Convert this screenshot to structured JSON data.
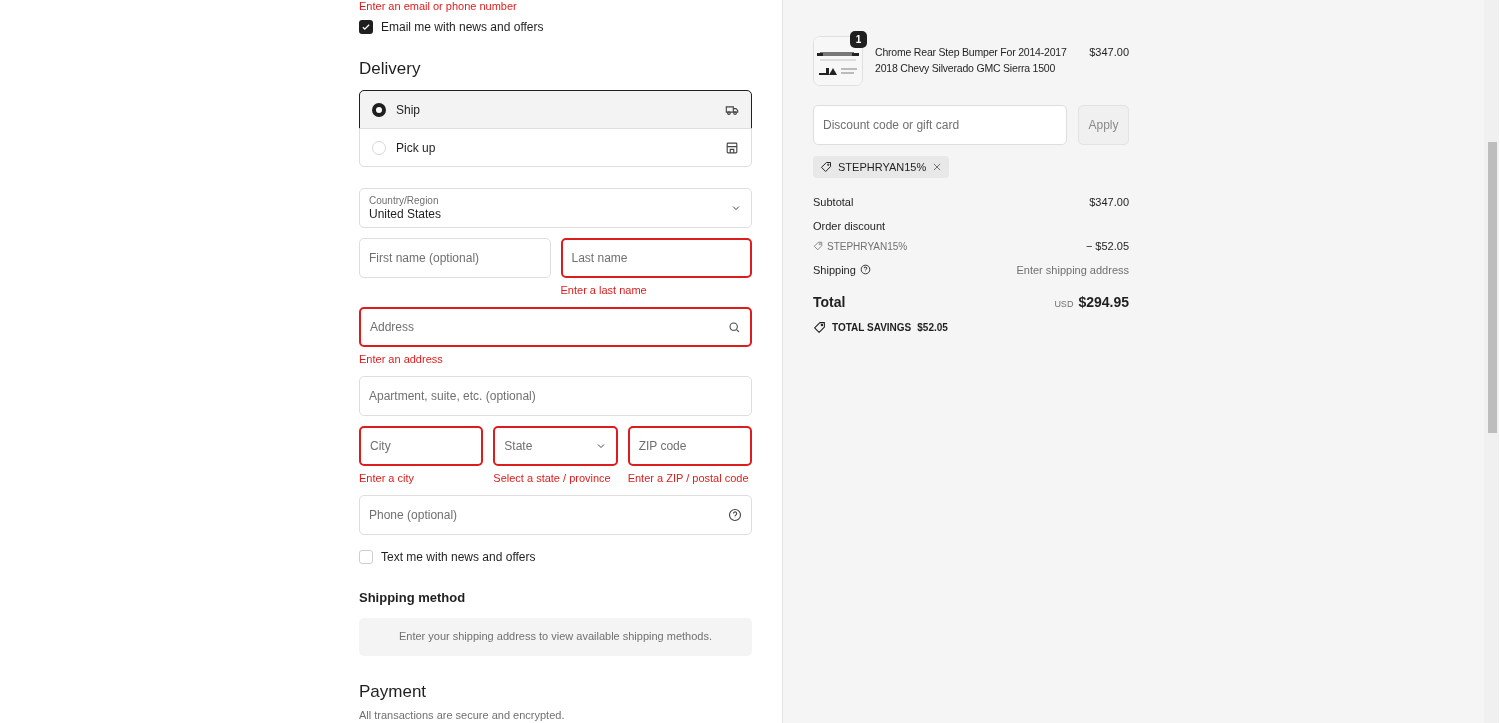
{
  "contact_error": "Enter an email or phone number",
  "email_optin": {
    "label": "Email me with news and offers",
    "checked": true
  },
  "delivery": {
    "title": "Delivery",
    "options": [
      {
        "label": "Ship",
        "selected": true
      },
      {
        "label": "Pick up",
        "selected": false
      }
    ]
  },
  "address_rows": [
    [
      {
        "kind": "select",
        "label": "Country/Region",
        "value": "United States",
        "invalid": false
      }
    ],
    [
      {
        "kind": "text",
        "placeholder": "First name (optional)",
        "invalid": false
      },
      {
        "kind": "text",
        "placeholder": "Last name",
        "invalid": true,
        "error": "Enter a last name"
      }
    ],
    [
      {
        "kind": "search",
        "placeholder": "Address",
        "invalid": true,
        "error": "Enter an address"
      }
    ],
    [
      {
        "kind": "text",
        "placeholder": "Apartment, suite, etc. (optional)",
        "invalid": false
      }
    ],
    [
      {
        "kind": "text",
        "placeholder": "City",
        "invalid": true,
        "error": "Enter a city"
      },
      {
        "kind": "dropdown",
        "placeholder": "State",
        "invalid": true,
        "error": "Select a state / province"
      },
      {
        "kind": "text",
        "placeholder": "ZIP code",
        "invalid": true,
        "error": "Enter a ZIP / postal code"
      }
    ],
    [
      {
        "kind": "help",
        "placeholder": "Phone (optional)",
        "invalid": false
      }
    ]
  ],
  "sms_optin": {
    "label": "Text me with news and offers",
    "checked": false
  },
  "shipping_method": {
    "title": "Shipping method",
    "message": "Enter your shipping address to view available shipping methods."
  },
  "payment": {
    "title": "Payment",
    "subtitle": "All transactions are secure and encrypted."
  },
  "summary": {
    "item": {
      "quantity": "1",
      "name": "Chrome Rear Step Bumper For 2014-2017 2018 Chevy Silverado GMC Sierra 1500",
      "price": "$347.00"
    },
    "discount_field": {
      "placeholder": "Discount code or gift card"
    },
    "apply_button": "Apply",
    "applied_code": "STEPHRYAN15%",
    "subtotal": {
      "label": "Subtotal",
      "value": "$347.00"
    },
    "order_discount": {
      "label": "Order discount",
      "code": "STEPHRYAN15%",
      "value": "− $52.05"
    },
    "shipping": {
      "label": "Shipping",
      "value": "Enter shipping address"
    },
    "total": {
      "label": "Total",
      "currency": "USD",
      "value": "$294.95"
    },
    "savings": {
      "label": "TOTAL SAVINGS",
      "value": "$52.05"
    }
  }
}
